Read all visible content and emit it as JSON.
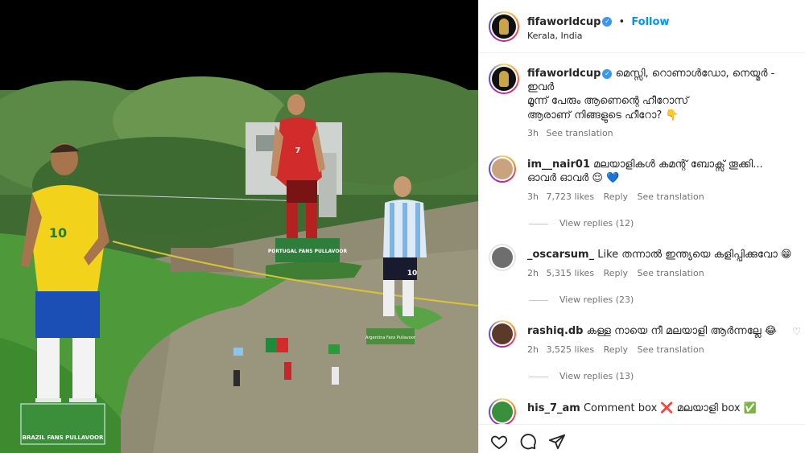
{
  "post": {
    "username": "fifaworldcup",
    "location": "Kerala, India",
    "follow_label": "Follow",
    "verified_mark": "✓",
    "caption_line1": "മെസ്സി, റൊണാൾഡോ, നെയ്മർ - ഇവർ",
    "caption_line2": "മൂന്ന് പേരും ആണെന്റെ ഹീറോസ്",
    "caption_line3": "ആരാണ് നിങ്ങളുടെ ഹീറോ? 👇",
    "caption_time": "3h",
    "see_translation": "See translation"
  },
  "photo": {
    "sign_brazil": "BRAZIL FANS PULLAVOOR",
    "sign_portugal": "PORTUGAL FANS PULLAVOOR",
    "sign_argentina": "Argentina Fans Pullavoor",
    "number_brazil": "10",
    "number_portugal": "7",
    "number_argentina": "10"
  },
  "comments": [
    {
      "username": "im__nair01",
      "text": "മലയാളികൾ കമന്റ് ബോക്സ് തൂക്കി...",
      "text2": "ഓവർ ഓവർ 😌 💙",
      "time": "3h",
      "likes": "7,723 likes",
      "reply": "Reply",
      "see_translation": "See translation",
      "view_replies": "View replies (12)"
    },
    {
      "username": "_oscarsum_",
      "text": "Like തന്നാൽ ഇന്ത്യയെ കളിപ്പിക്കുവോ 😁",
      "time": "2h",
      "likes": "5,315 likes",
      "reply": "Reply",
      "see_translation": "See translation",
      "view_replies": "View replies (23)"
    },
    {
      "username": "rashiq.db",
      "text": "കള്ള നായെ നീ മലയാളി ആർന്നല്ലേ 😂",
      "time": "2h",
      "likes": "3,525 likes",
      "reply": "Reply",
      "see_translation": "See translation",
      "view_replies": "View replies (13)"
    },
    {
      "username": "his_7_am",
      "text": "Comment box ❌ മലയാളി box ✅"
    }
  ],
  "icons": {
    "like": "heart-icon",
    "comment": "comment-icon",
    "share": "share-icon",
    "comment_like": "heart-outline-icon"
  },
  "colors": {
    "follow": "#0095f6",
    "verified": "#3897f0",
    "meta_text": "#737373"
  }
}
